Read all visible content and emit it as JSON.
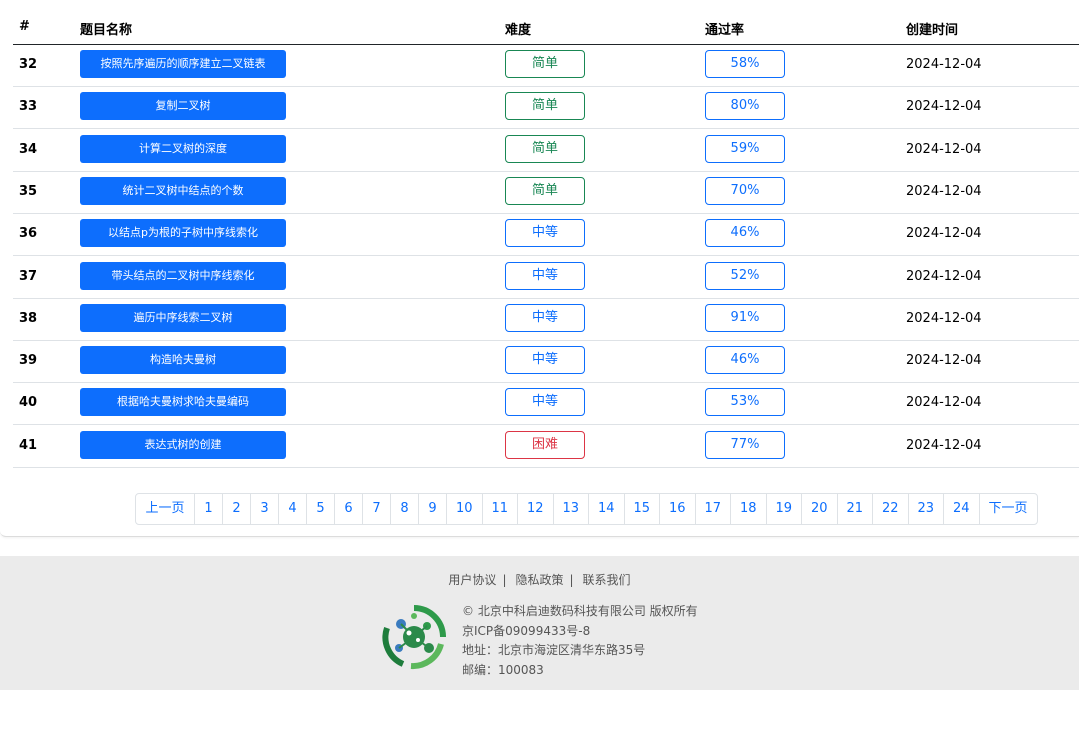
{
  "table": {
    "headers": [
      "#",
      "题目名称",
      "难度",
      "通过率",
      "创建时间"
    ],
    "rows": [
      {
        "num": "32",
        "title": "按照先序遍历的顺序建立二叉链表",
        "difficulty": "简单",
        "level": "easy",
        "rate": "58%",
        "date": "2024-12-04"
      },
      {
        "num": "33",
        "title": "复制二叉树",
        "difficulty": "简单",
        "level": "easy",
        "rate": "80%",
        "date": "2024-12-04"
      },
      {
        "num": "34",
        "title": "计算二叉树的深度",
        "difficulty": "简单",
        "level": "easy",
        "rate": "59%",
        "date": "2024-12-04"
      },
      {
        "num": "35",
        "title": "统计二叉树中结点的个数",
        "difficulty": "简单",
        "level": "easy",
        "rate": "70%",
        "date": "2024-12-04"
      },
      {
        "num": "36",
        "title": "以结点p为根的子树中序线索化",
        "difficulty": "中等",
        "level": "medium",
        "rate": "46%",
        "date": "2024-12-04"
      },
      {
        "num": "37",
        "title": "带头结点的二叉树中序线索化",
        "difficulty": "中等",
        "level": "medium",
        "rate": "52%",
        "date": "2024-12-04"
      },
      {
        "num": "38",
        "title": "遍历中序线索二叉树",
        "difficulty": "中等",
        "level": "medium",
        "rate": "91%",
        "date": "2024-12-04"
      },
      {
        "num": "39",
        "title": "构造哈夫曼树",
        "difficulty": "中等",
        "level": "medium",
        "rate": "46%",
        "date": "2024-12-04"
      },
      {
        "num": "40",
        "title": "根据哈夫曼树求哈夫曼编码",
        "difficulty": "中等",
        "level": "medium",
        "rate": "53%",
        "date": "2024-12-04"
      },
      {
        "num": "41",
        "title": "表达式树的创建",
        "difficulty": "困难",
        "level": "hard",
        "rate": "77%",
        "date": "2024-12-04"
      }
    ]
  },
  "pagination": {
    "prev": "上一页",
    "next": "下一页",
    "pages": [
      "1",
      "2",
      "3",
      "4",
      "5",
      "6",
      "7",
      "8",
      "9",
      "10",
      "11",
      "12",
      "13",
      "14",
      "15",
      "16",
      "17",
      "18",
      "19",
      "20",
      "21",
      "22",
      "23",
      "24"
    ]
  },
  "footer": {
    "links": [
      "用户协议",
      "隐私政策",
      "联系我们"
    ],
    "copyright": "© 北京中科启迪数码科技有限公司 版权所有",
    "icp": "京ICP备09099433号-8",
    "address": "地址：北京市海淀区清华东路35号",
    "postcode": "邮编：100083"
  },
  "colors": {
    "primary": "#0d6efd",
    "easy": "#198754",
    "medium": "#0d6efd",
    "hard": "#dc3545"
  }
}
